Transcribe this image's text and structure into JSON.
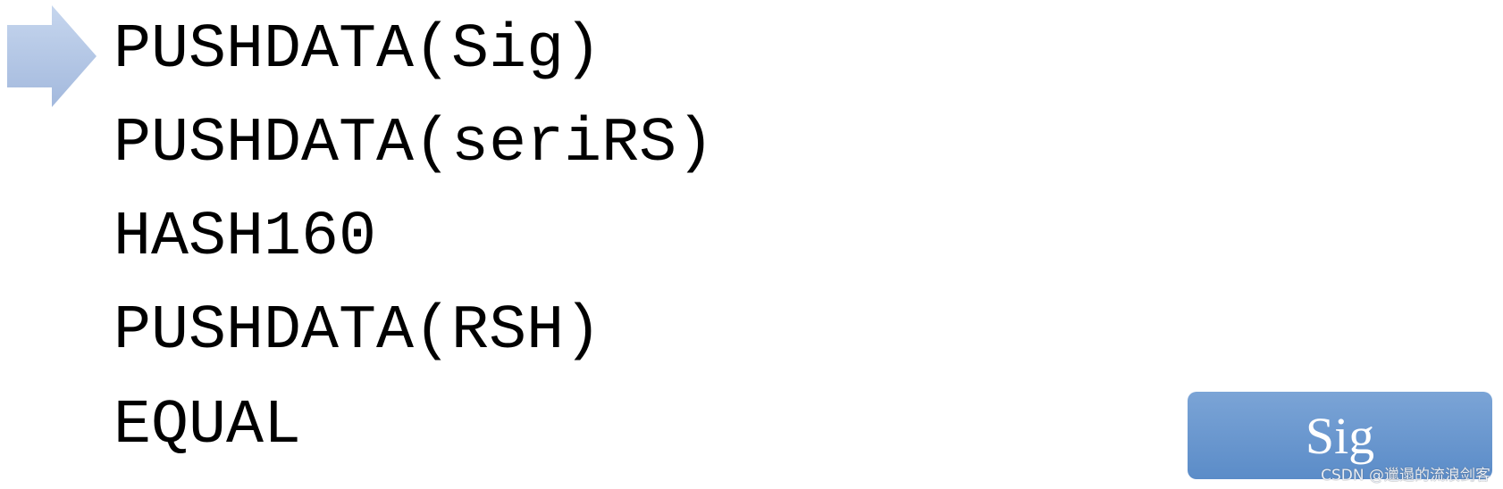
{
  "lines": [
    "PUSHDATA(Sig)",
    "PUSHDATA(seriRS)",
    "HASH160",
    "PUSHDATA(RSH)",
    "EQUAL"
  ],
  "current_line_marker": "arrow-right-icon",
  "stack": {
    "top_item": "Sig",
    "color": "#6b97cf"
  },
  "watermark": "CSDN @邋遢的流浪剑客"
}
